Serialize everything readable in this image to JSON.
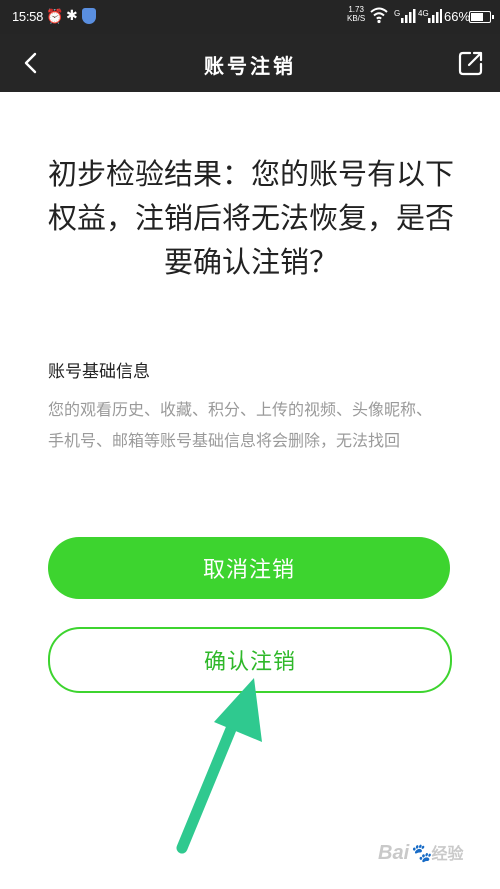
{
  "status_bar": {
    "time": "15:58",
    "net_speed": "1.73",
    "net_speed_unit": "KB/S",
    "signal1_label": "G",
    "signal2_label": "4G",
    "battery_percent": "66%",
    "battery_level": 0.66,
    "icons": [
      "alarm-icon",
      "bluetooth-icon",
      "shield-icon",
      "wifi-icon",
      "signal-icon",
      "battery-icon"
    ]
  },
  "header": {
    "title": "账号注销",
    "back_icon": "back-icon",
    "share_icon": "share-icon"
  },
  "main": {
    "headline": "初步检验结果：您的账号有以下权益，注销后将无法恢复，是否要确认注销？",
    "section": {
      "title": "账号基础信息",
      "description": "您的观看历史、收藏、积分、上传的视频、头像昵称、手机号、邮箱等账号基础信息将会删除，无法找回"
    },
    "cancel_button": "取消注销",
    "confirm_button": "确认注销"
  },
  "annotation": {
    "arrow_color": "#2fc98f"
  },
  "watermark": {
    "brand": "Bai",
    "suffix": "经验"
  },
  "colors": {
    "primary_green": "#3dd42f",
    "header_bg": "#262626",
    "text_primary": "#222222",
    "text_secondary": "#9a9a9a"
  }
}
